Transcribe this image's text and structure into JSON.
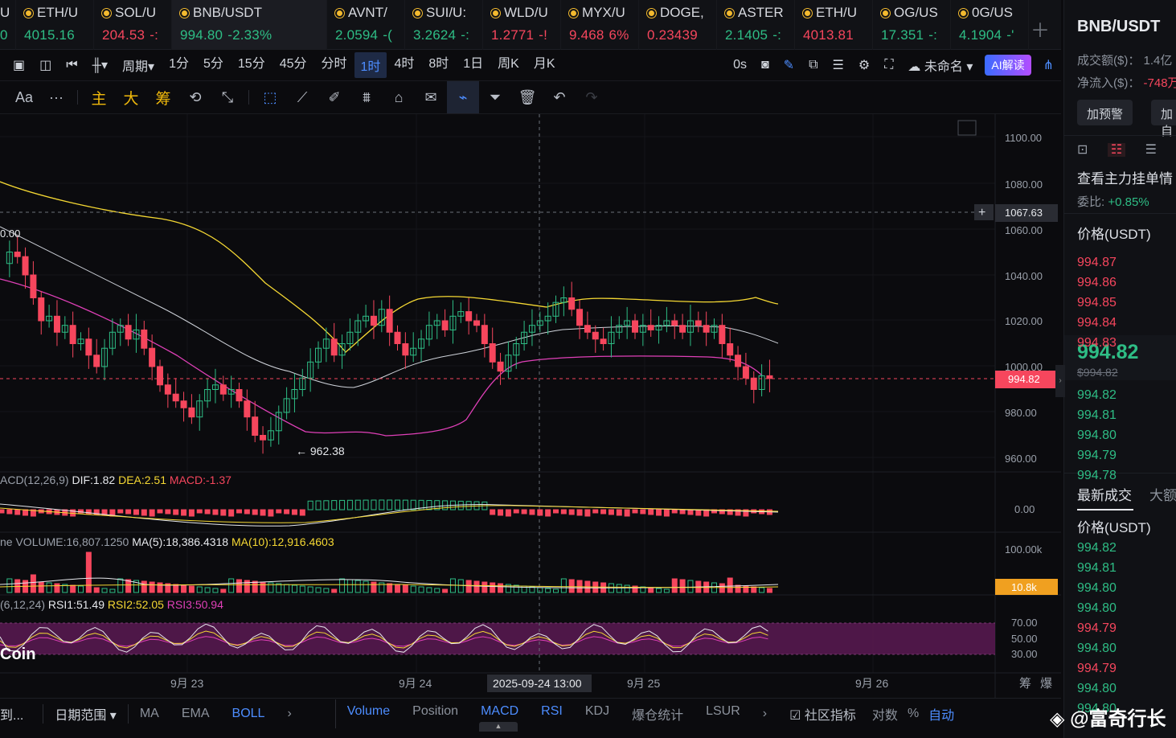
{
  "tabs": [
    {
      "name": "U",
      "price": "0",
      "change": "",
      "dir": "up"
    },
    {
      "name": "ETH/U",
      "price": "4015.16",
      "change": "",
      "dir": "up"
    },
    {
      "name": "SOL/U",
      "price": "204.53",
      "change": "-:",
      "dir": "dn"
    },
    {
      "name": "BNB/USDT",
      "price": "994.80",
      "change": "-2.33%",
      "dir": "up",
      "active": true
    },
    {
      "name": "AVNT/",
      "price": "2.0594",
      "change": "-(",
      "dir": "up"
    },
    {
      "name": "SUI/U:",
      "price": "3.2624",
      "change": "-:",
      "dir": "up"
    },
    {
      "name": "WLD/U",
      "price": "1.2771",
      "change": "-!",
      "dir": "dn"
    },
    {
      "name": "MYX/U",
      "price": "9.468",
      "change": "6%",
      "dir": "dn"
    },
    {
      "name": "DOGE,",
      "price": "0.23439",
      "change": "",
      "dir": "dn"
    },
    {
      "name": "ASTER",
      "price": "2.1405",
      "change": "-:",
      "dir": "up"
    },
    {
      "name": "ETH/U",
      "price": "4013.81",
      "change": "",
      "dir": "dn"
    },
    {
      "name": "OG/US",
      "price": "17.351",
      "change": "-:",
      "dir": "up"
    },
    {
      "name": "0G/US",
      "price": "4.1904",
      "change": "-'",
      "dir": "up"
    }
  ],
  "toolbar1": {
    "period_label": "周期",
    "intervals": [
      "1分",
      "5分",
      "15分",
      "45分",
      "分时",
      "1时",
      "4时",
      "8时",
      "1日",
      "周K",
      "月K"
    ],
    "selected_interval": "1时",
    "countdown": "0s",
    "layout_name": "未命名",
    "ai_label": "AI解读"
  },
  "toolbar2": {
    "font_label": "Aa",
    "more": "···",
    "gold_labels": [
      "主",
      "大",
      "筹"
    ]
  },
  "chart": {
    "price_ticks": [
      "1100.00",
      "1080.00",
      "1060.00",
      "1040.00",
      "1020.00",
      "1000.00",
      "980.00",
      "960.00"
    ],
    "crosshair_price": "1067.63",
    "last_price": "994.82",
    "left_marker": "0.00",
    "low_marker": "← 962.38",
    "macd_legend": {
      "name": "ACD(12,26,9)",
      "dif": "DIF:1.82",
      "dea": "DEA:2.51",
      "macd": "MACD:-1.37"
    },
    "macd_tick": "0.00",
    "volume_legend": {
      "name": "ne VOLUME:16,807.1250",
      "ma5": "MA(5):18,386.4318",
      "ma10": "MA(10):12,916.4603"
    },
    "volume_tick": "100.00k",
    "volume_last": "10.8k",
    "rsi_legend": {
      "name": "(6,12,24)",
      "rsi1": "RSI1:51.49",
      "rsi2": "RSI2:52.05",
      "rsi3": "RSI3:50.94"
    },
    "rsi_ticks": [
      "70.00",
      "50.00",
      "30.00"
    ],
    "coin_mark": "Coin",
    "date_labels": [
      "9月 23",
      "9月 24",
      "9月 25",
      "9月 26"
    ],
    "crosshair_date": "2025-09-24 13:00",
    "corner_icons": [
      "筹",
      "爆"
    ],
    "colors": {
      "up": "#2ebd85",
      "down": "#f6465d",
      "boll_upper": "#f5d833",
      "boll_mid": "#cfd3da",
      "boll_lower": "#e040b8",
      "rsi_band": "#5a1a52"
    }
  },
  "chart_data": {
    "type": "candlestick",
    "title": "BNB/USDT",
    "interval": "1时",
    "ylim": [
      955,
      1105
    ],
    "x_labels": [
      "9月 23",
      "9月 24",
      "9月 25",
      "9月 26"
    ],
    "last_price": 994.82,
    "low": 962.38,
    "indicators": [
      "BOLL",
      "MACD",
      "VOLUME",
      "RSI"
    ]
  },
  "bottom": {
    "left_cut": "到...",
    "date_range": "日期范围",
    "main_inds": [
      "MA",
      "EMA",
      "BOLL"
    ],
    "sub_inds": [
      "Volume",
      "Position",
      "MACD",
      "RSI",
      "KDJ",
      "爆仓统计",
      "LSUR"
    ],
    "active": [
      "BOLL",
      "Volume",
      "MACD",
      "RSI"
    ],
    "community": "社区指标",
    "log": "对数",
    "pct": "%",
    "auto": "自动"
  },
  "side": {
    "title": "BNB/USDT",
    "turnover": "成交额($)： 1.4亿",
    "netflow_label": "净流入($)：",
    "netflow_value": "-748万",
    "alert_btn": "加预警",
    "add_btn": "加自",
    "orders_title": "查看主力挂单情",
    "ratio_label": "委比:",
    "ratio_value": "+0.85%",
    "price_header": "价格(USDT)",
    "asks": [
      "994.87",
      "994.86",
      "994.85",
      "994.84",
      "994.83"
    ],
    "mid_price": "994.82",
    "mid_sub": "$994.82",
    "bids": [
      "994.82",
      "994.81",
      "994.80",
      "994.79",
      "994.78"
    ],
    "trades_title": "最新成交",
    "trades_tab2": "大额",
    "trades_price_header": "价格(USDT)",
    "trades": [
      {
        "p": "994.82",
        "d": "up"
      },
      {
        "p": "994.81",
        "d": "up"
      },
      {
        "p": "994.80",
        "d": "up"
      },
      {
        "p": "994.80",
        "d": "up"
      },
      {
        "p": "994.79",
        "d": "dn"
      },
      {
        "p": "994.80",
        "d": "up"
      },
      {
        "p": "994.79",
        "d": "dn"
      },
      {
        "p": "994.80",
        "d": "up"
      },
      {
        "p": "994.80",
        "d": "up"
      }
    ]
  },
  "watermark": "◈ @富奇行长"
}
